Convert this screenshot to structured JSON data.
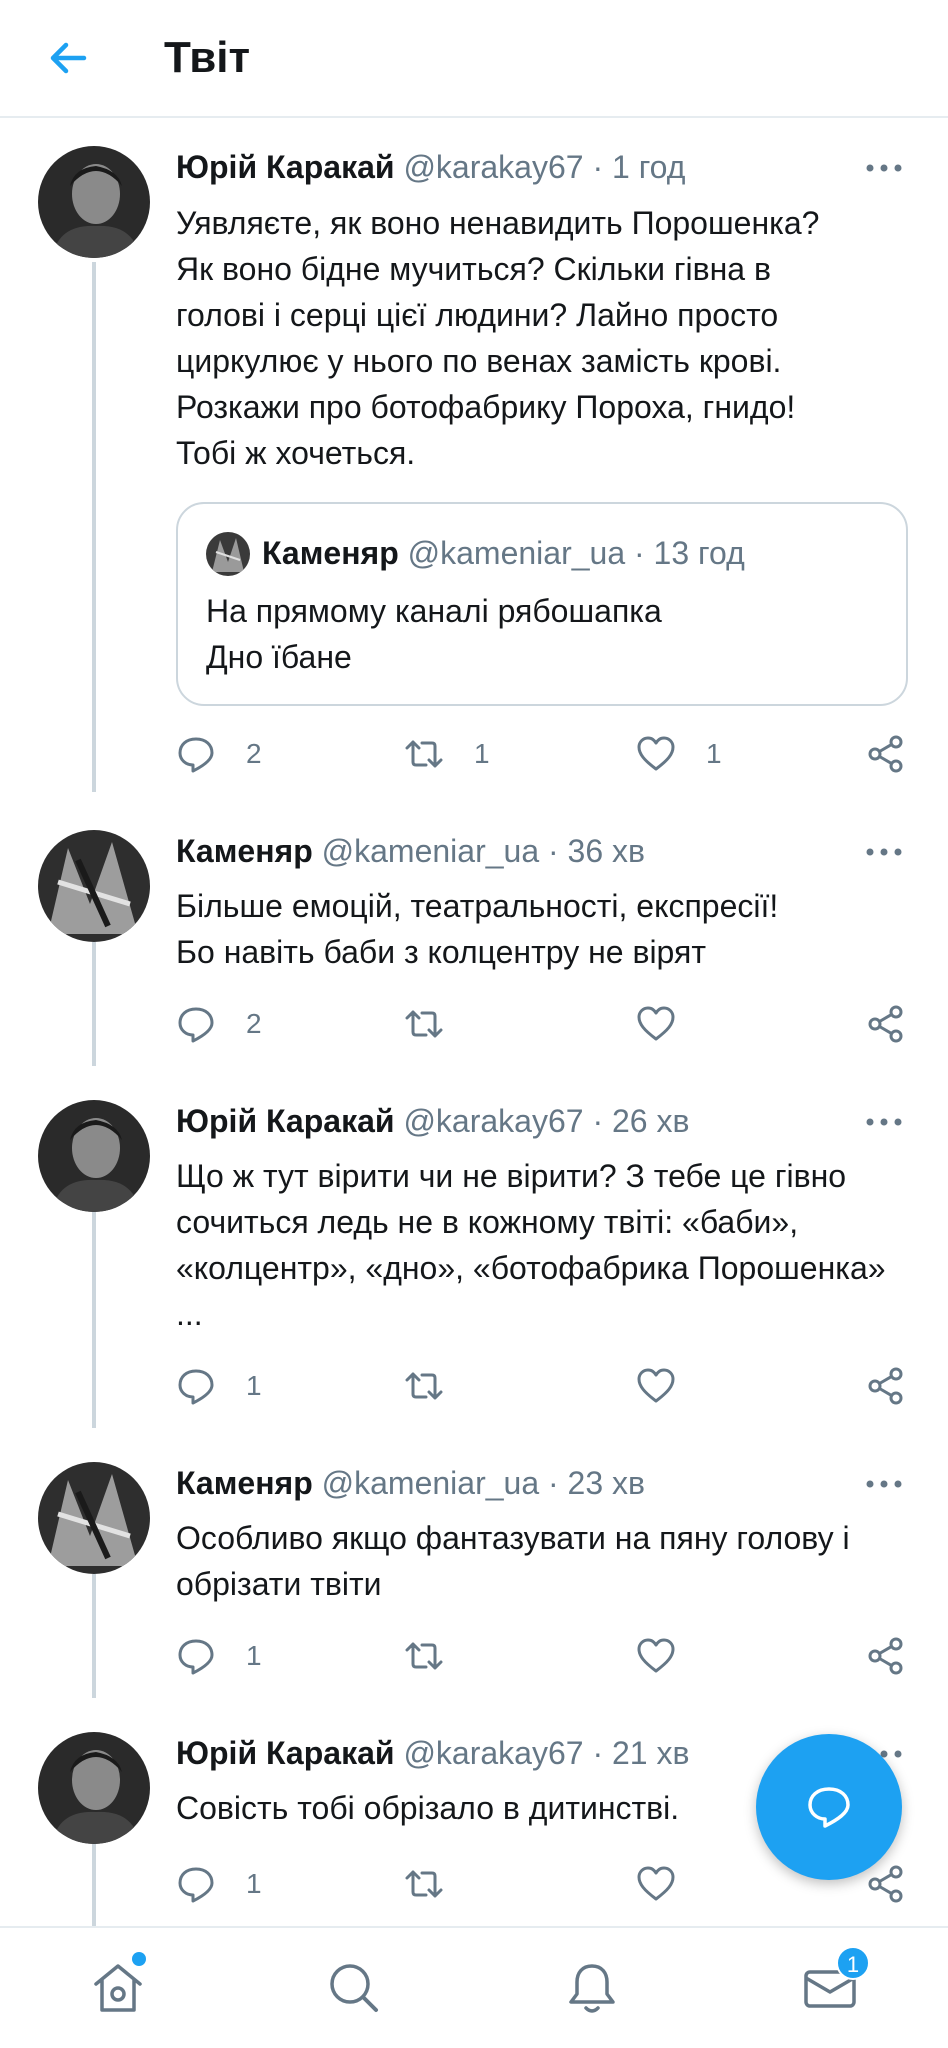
{
  "header": {
    "title": "Твіт"
  },
  "tweets": [
    {
      "name": "Юрій Каракай",
      "handle": "@karakay67",
      "time": "1 год",
      "lines": [
        "Уявляєте, як воно ненавидить Порошенка?",
        "Як воно бідне мучиться? Скільки гівна в",
        "голові і серці цієї людини? Лайно просто",
        "циркулює у нього по венах замість крові.",
        "Розкажи про ботофабрику Пороха, гнидо!",
        "Тобі ж хочеться."
      ],
      "quote": {
        "name": "Каменяр",
        "handle": "@kameniar_ua",
        "time": "13 год",
        "lines": [
          "На прямому каналі рябошапка",
          "Дно їбане"
        ]
      },
      "replies": "2",
      "retweets": "1",
      "likes": "1"
    },
    {
      "name": "Каменяр",
      "handle": "@kameniar_ua",
      "time": "36 хв",
      "lines": [
        "Більше емоцій, театральності, експресії!",
        "Бо навіть баби з колцентру не вірят"
      ],
      "replies": "2",
      "retweets": "",
      "likes": ""
    },
    {
      "name": "Юрій Каракай",
      "handle": "@karakay67",
      "time": "26 хв",
      "lines": [
        "Що ж тут вірити чи не вірити? З тебе це гівно",
        "сочиться ледь не в кожному твіті: «баби»,",
        "«колцентр», «дно», «ботофабрика Порошенка»",
        "..."
      ],
      "replies": "1",
      "retweets": "",
      "likes": ""
    },
    {
      "name": "Каменяр",
      "handle": "@kameniar_ua",
      "time": "23 хв",
      "lines": [
        "Особливо якщо фантазувати на пяну голову і",
        "обрізати твіти"
      ],
      "replies": "1",
      "retweets": "",
      "likes": ""
    },
    {
      "name": "Юрій Каракай",
      "handle": "@karakay67",
      "time": "21 хв",
      "lines": [
        "Совість тобі обрізало в дитинстві."
      ],
      "replies": "1",
      "retweets": "",
      "likes": ""
    }
  ],
  "nav": {
    "messages_badge": "1"
  },
  "colors": {
    "accent": "#1da1f2",
    "muted": "#657786",
    "divider": "#e6ecf0"
  },
  "icons": [
    "back-arrow-icon",
    "more-icon",
    "reply-icon",
    "retweet-icon",
    "like-icon",
    "share-icon",
    "compose-reply-icon",
    "home-icon",
    "search-icon",
    "bell-icon",
    "mail-icon"
  ]
}
